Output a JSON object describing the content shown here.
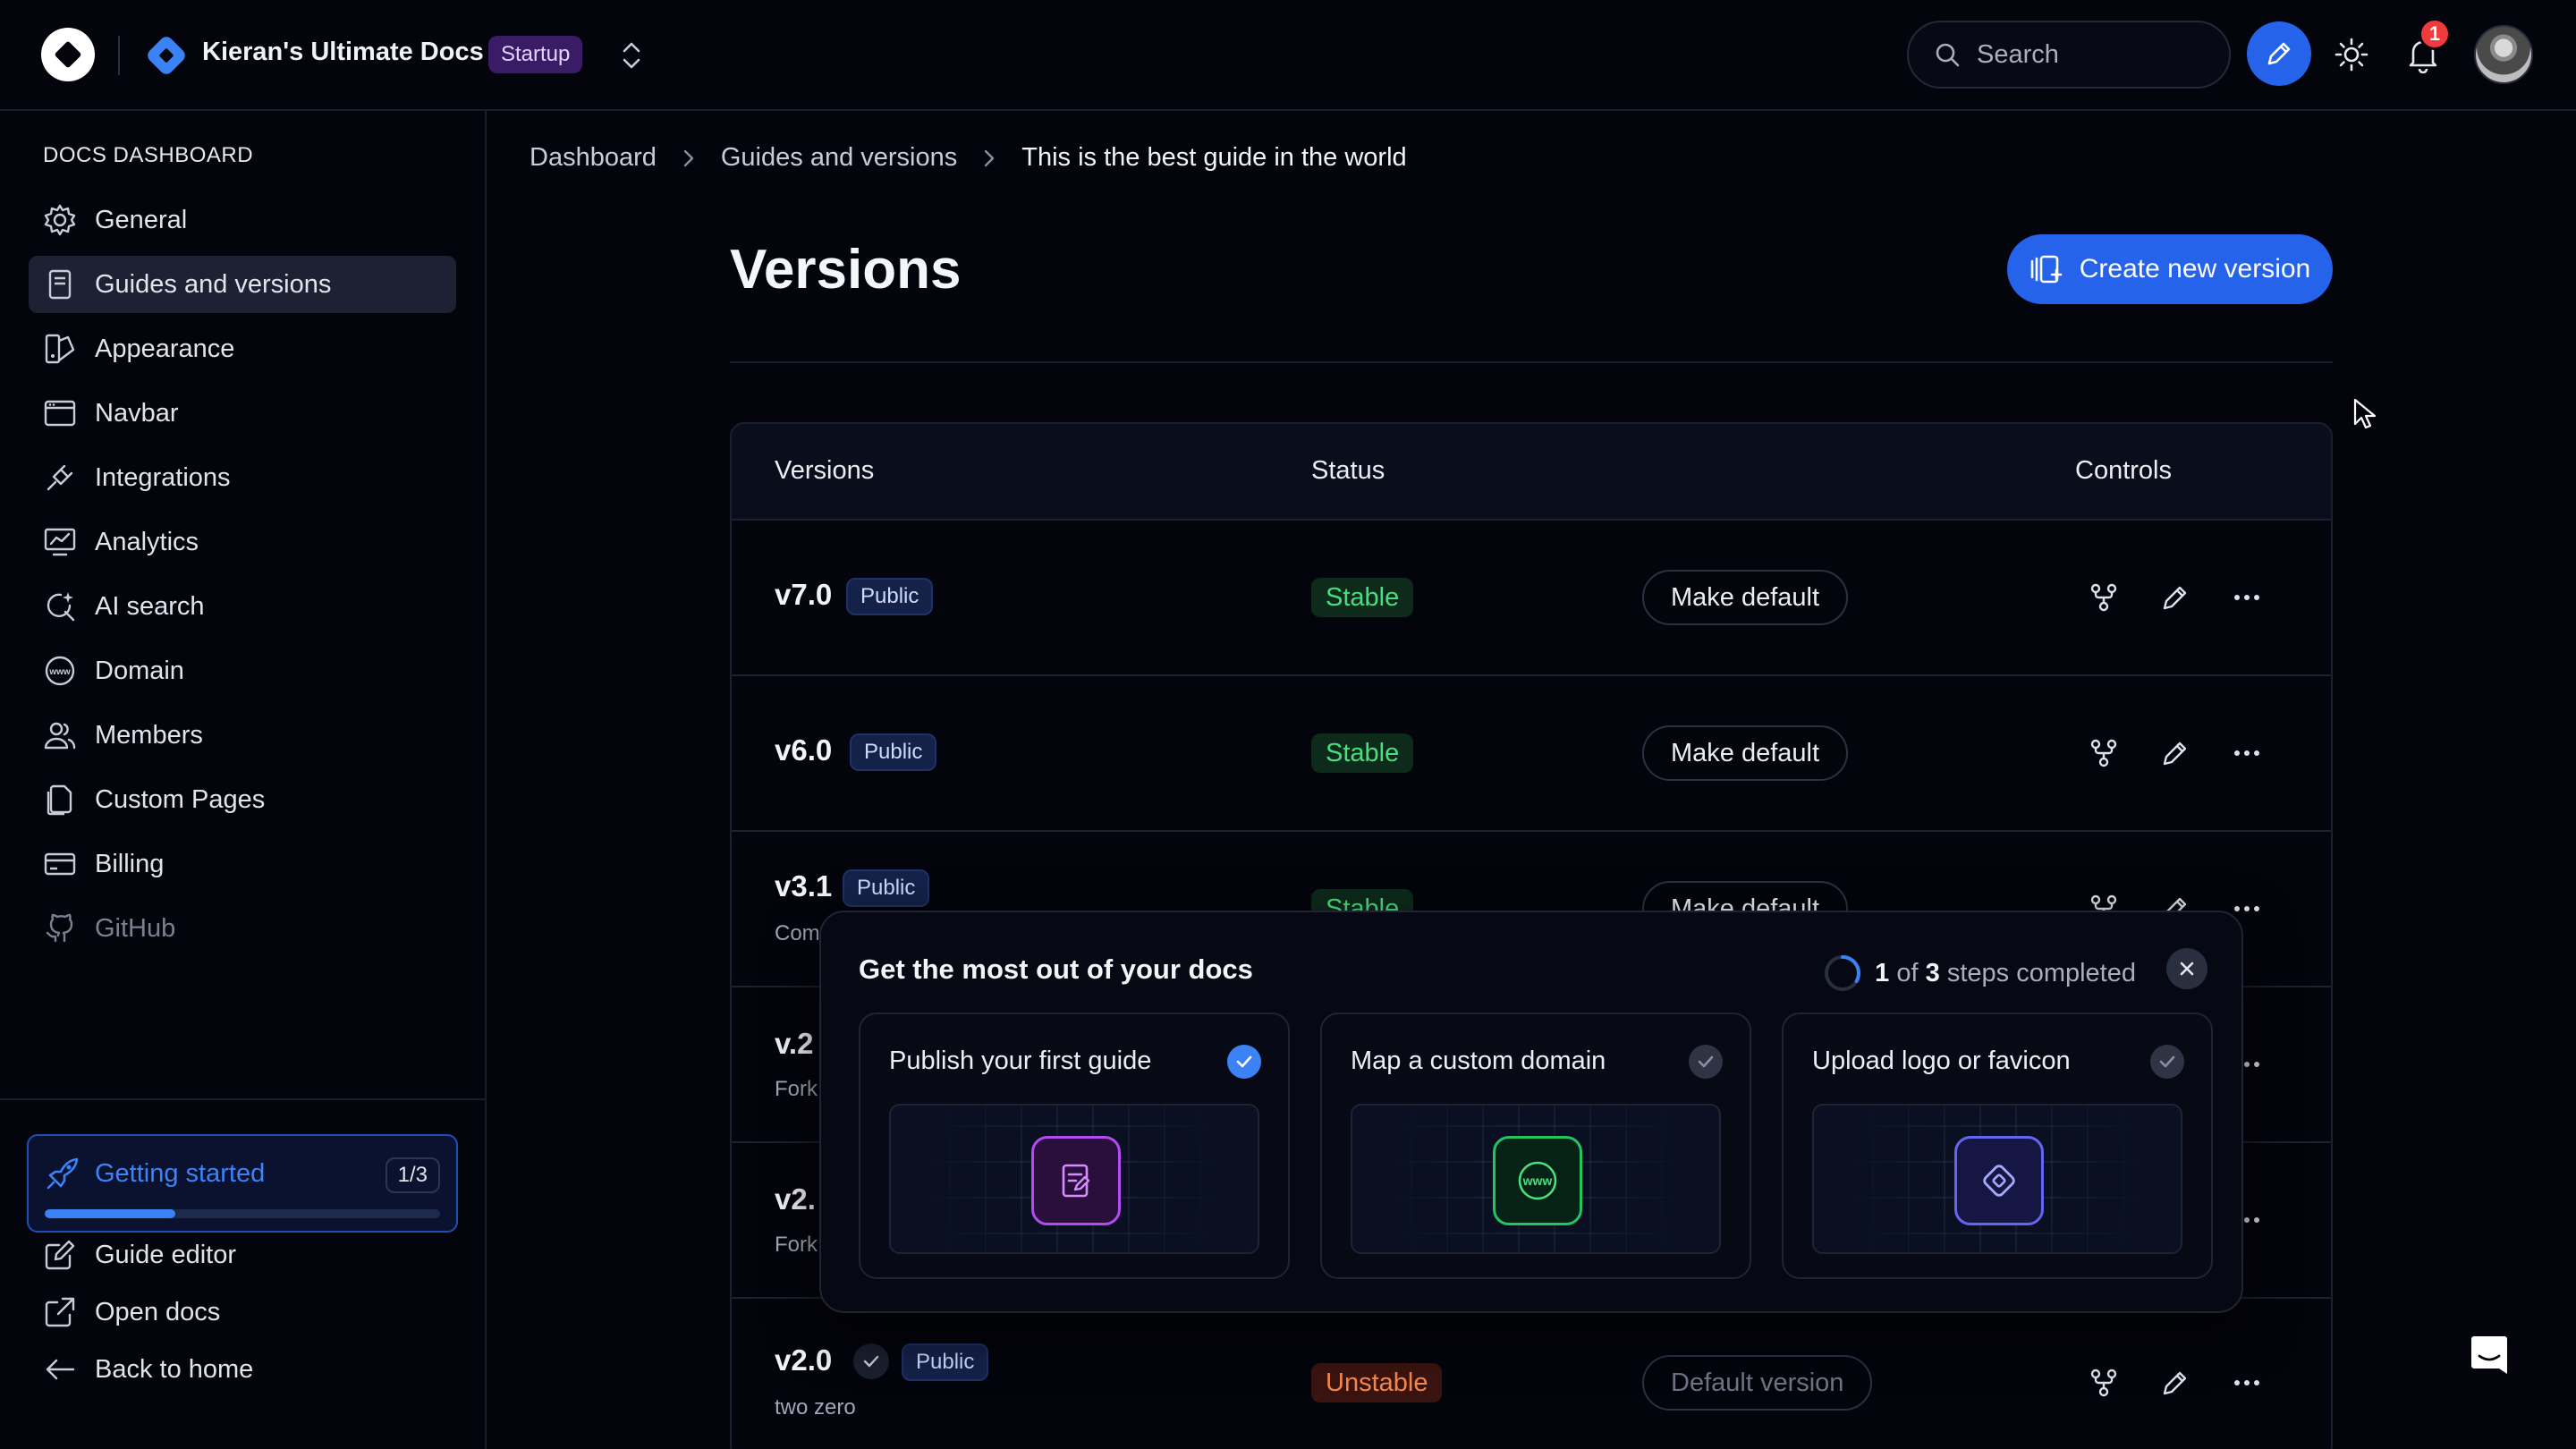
{
  "topbar": {
    "project_name": "Kieran's Ultimate Docs",
    "plan_badge": "Startup",
    "search_placeholder": "Search",
    "notification_count": "1"
  },
  "sidebar": {
    "heading": "DOCS DASHBOARD",
    "items": [
      {
        "label": "General",
        "icon": "gear-icon"
      },
      {
        "label": "Guides and versions",
        "icon": "document-icon",
        "active": true
      },
      {
        "label": "Appearance",
        "icon": "palette-icon"
      },
      {
        "label": "Navbar",
        "icon": "window-icon"
      },
      {
        "label": "Integrations",
        "icon": "plug-icon"
      },
      {
        "label": "Analytics",
        "icon": "chart-icon"
      },
      {
        "label": "AI search",
        "icon": "ai-search-icon"
      },
      {
        "label": "Domain",
        "icon": "www-icon"
      },
      {
        "label": "Members",
        "icon": "users-icon"
      },
      {
        "label": "Custom Pages",
        "icon": "pages-icon"
      },
      {
        "label": "Billing",
        "icon": "card-icon"
      },
      {
        "label": "GitHub",
        "icon": "github-icon",
        "disabled": true
      }
    ],
    "getting_started": {
      "label": "Getting started",
      "count": "1/3",
      "progress": 0.33
    },
    "footer": [
      {
        "label": "Guide editor",
        "icon": "edit-icon"
      },
      {
        "label": "Open docs",
        "icon": "external-link-icon"
      },
      {
        "label": "Back to home",
        "icon": "arrow-left-icon"
      }
    ]
  },
  "breadcrumb": [
    "Dashboard",
    "Guides and versions",
    "This is the best guide in the world"
  ],
  "page": {
    "title": "Versions",
    "create_button": "Create new version"
  },
  "table": {
    "headers": {
      "versions": "Versions",
      "status": "Status",
      "controls": "Controls"
    },
    "rows": [
      {
        "version": "v7.0",
        "badge": "Public",
        "status": "Stable",
        "action": "Make default"
      },
      {
        "version": "v6.0",
        "badge": "Public",
        "status": "Stable",
        "action": "Make default"
      },
      {
        "version": "v3.1",
        "badge": "Public",
        "sub": "Com",
        "status": "Stable",
        "action": "Make default"
      },
      {
        "version": "v.2",
        "sub": "Fork"
      },
      {
        "version": "v2.",
        "sub": "Fork"
      },
      {
        "version": "v2.0",
        "badge": "Public",
        "sub": "two zero",
        "status": "Unstable",
        "action": "Default version"
      }
    ]
  },
  "onboarding": {
    "title": "Get the most out of your docs",
    "steps_done": "1",
    "steps_of": "of",
    "steps_total": "3",
    "steps_suffix": "steps completed",
    "cards": [
      {
        "label": "Publish your first guide",
        "done": true,
        "icon": "guide-icon",
        "color": "#b34cf0"
      },
      {
        "label": "Map a custom domain",
        "done": false,
        "icon": "www-icon",
        "color": "#22c55e"
      },
      {
        "label": "Upload logo or favicon",
        "done": false,
        "icon": "logo-icon",
        "color": "#6366f1"
      }
    ]
  },
  "colors": {
    "accent": "#2563eb",
    "stable": "#4ade80",
    "unstable": "#f5874f",
    "badge": "#3a1c66"
  }
}
